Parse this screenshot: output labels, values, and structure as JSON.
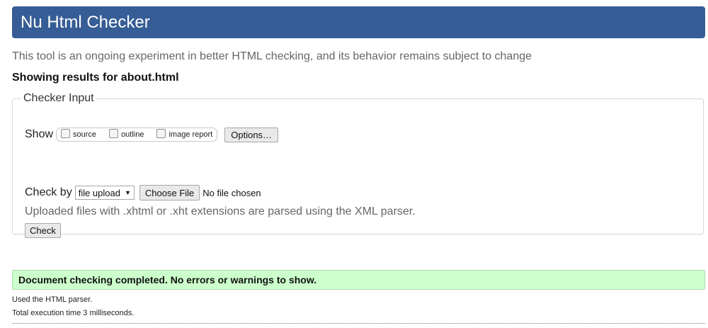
{
  "header": {
    "title": "Nu Html Checker"
  },
  "intro": "This tool is an ongoing experiment in better HTML checking, and its behavior remains subject to change",
  "results_for": "Showing results for about.html",
  "checker_input": {
    "legend": "Checker Input",
    "show_label": "Show",
    "show_options": [
      {
        "label": "source",
        "checked": false
      },
      {
        "label": "outline",
        "checked": false
      },
      {
        "label": "image report",
        "checked": false
      }
    ],
    "options_button": "Options…",
    "check_by_label": "Check by",
    "check_by_selected": "file upload",
    "choose_file_button": "Choose File",
    "no_file_text": "No file chosen",
    "xml_note": "Uploaded files with .xhtml or .xht extensions are parsed using the XML parser.",
    "check_button": "Check"
  },
  "result": {
    "success_message": "Document checking completed. No errors or warnings to show.",
    "parser_note": "Used the HTML parser.",
    "execution_note": "Total execution time 3 milliseconds."
  },
  "colors": {
    "header_bg": "#365d95",
    "success_bg": "#ccffcc"
  }
}
